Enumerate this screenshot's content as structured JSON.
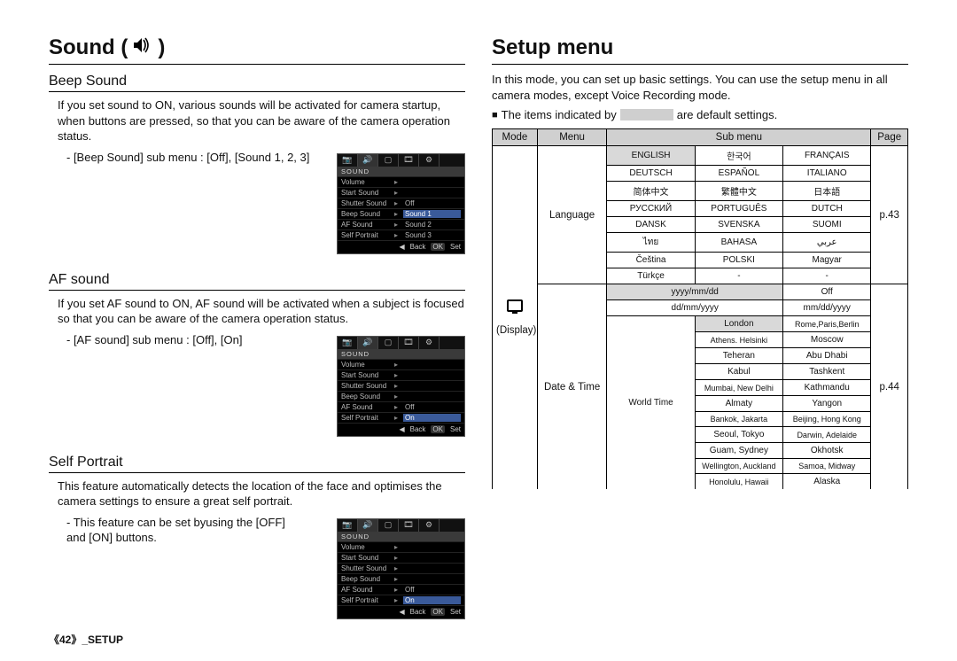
{
  "footer": "《42》_SETUP",
  "left": {
    "title_prefix": "Sound (",
    "title_suffix": ")",
    "sections": {
      "beep": {
        "heading": "Beep Sound",
        "body": "If you set sound to ON, various sounds will be activated for camera startup, when buttons are pressed, so that you can be aware of the camera operation status.",
        "submenu": "- [Beep Sound] sub menu : [Off], [Sound 1, 2, 3]",
        "lcd": {
          "group": "SOUND",
          "rows": [
            {
              "k": "Volume",
              "v": "",
              "sel": false
            },
            {
              "k": "Start Sound",
              "v": "",
              "sel": false
            },
            {
              "k": "Shutter Sound",
              "v": "Off",
              "sel": false
            },
            {
              "k": "Beep Sound",
              "v": "Sound 1",
              "sel": true
            },
            {
              "k": "AF Sound",
              "v": "Sound 2",
              "sel": false
            },
            {
              "k": "Self Portrait",
              "v": "Sound 3",
              "sel": false
            }
          ]
        }
      },
      "af": {
        "heading": "AF sound",
        "body": "If you set AF sound to ON, AF sound will be activated when a subject is focused so that you can be aware of the camera operation status.",
        "submenu": "- [AF sound] sub menu : [Off], [On]",
        "lcd": {
          "group": "SOUND",
          "rows": [
            {
              "k": "Volume",
              "v": "",
              "sel": false
            },
            {
              "k": "Start Sound",
              "v": "",
              "sel": false
            },
            {
              "k": "Shutter Sound",
              "v": "",
              "sel": false
            },
            {
              "k": "Beep Sound",
              "v": "",
              "sel": false
            },
            {
              "k": "AF Sound",
              "v": "Off",
              "sel": false
            },
            {
              "k": "Self Portrait",
              "v": "On",
              "sel": true
            }
          ]
        }
      },
      "self": {
        "heading": "Self Portrait",
        "body": "This feature automatically detects the location of the face and optimises the camera settings to ensure a great self portrait.",
        "submenu": "- This feature can be set byusing the [OFF] and [ON] buttons.",
        "lcd": {
          "group": "SOUND",
          "rows": [
            {
              "k": "Volume",
              "v": "",
              "sel": false
            },
            {
              "k": "Start Sound",
              "v": "",
              "sel": false
            },
            {
              "k": "Shutter Sound",
              "v": "",
              "sel": false
            },
            {
              "k": "Beep Sound",
              "v": "",
              "sel": false
            },
            {
              "k": "AF Sound",
              "v": "Off",
              "sel": false
            },
            {
              "k": "Self Portrait",
              "v": "On",
              "sel": true
            }
          ]
        }
      },
      "lcd_footer": {
        "back": "Back",
        "ok": "OK",
        "set": "Set"
      }
    }
  },
  "right": {
    "title": "Setup menu",
    "intro": "In this mode, you can set up basic settings. You can use the setup menu in all camera modes, except Voice Recording mode.",
    "note_prefix": "The items indicated by",
    "note_suffix": "are default settings.",
    "table": {
      "headers": {
        "mode": "Mode",
        "menu": "Menu",
        "submenu": "Sub menu",
        "page": "Page"
      },
      "mode_label": "(Display)",
      "language": {
        "label": "Language",
        "page": "p.43",
        "rows": [
          [
            "ENGLISH",
            "한국어",
            "FRANÇAIS"
          ],
          [
            "DEUTSCH",
            "ESPAÑOL",
            "ITALIANO"
          ],
          [
            "简体中文",
            "繁體中文",
            "日本語"
          ],
          [
            "РУССКИЙ",
            "PORTUGUÊS",
            "DUTCH"
          ],
          [
            "DANSK",
            "SVENSKA",
            "SUOMI"
          ],
          [
            "ไทย",
            "BAHASA",
            "عربي"
          ],
          [
            "Čeština",
            "POLSKI",
            "Magyar"
          ],
          [
            "Türkçe",
            "-",
            "-"
          ]
        ]
      },
      "datetime": {
        "label": "Date & Time",
        "page": "p.44",
        "format_rows": [
          {
            "a": "yyyy/mm/dd",
            "b": "Off",
            "default": "a"
          },
          {
            "a": "dd/mm/yyyy",
            "b": "mm/dd/yyyy",
            "default": null
          }
        ],
        "worldtime_label": "World Time",
        "cities": [
          [
            "London",
            "Rome,Paris,Berlin"
          ],
          [
            "Athens. Helsinki",
            "Moscow"
          ],
          [
            "Teheran",
            "Abu Dhabi"
          ],
          [
            "Kabul",
            "Tashkent"
          ],
          [
            "Mumbai, New Delhi",
            "Kathmandu"
          ],
          [
            "Almaty",
            "Yangon"
          ],
          [
            "Bankok, Jakarta",
            "Beijing, Hong Kong"
          ],
          [
            "Seoul, Tokyo",
            "Darwin, Adelaide"
          ],
          [
            "Guam, Sydney",
            "Okhotsk"
          ],
          [
            "Wellington, Auckland",
            "Samoa, Midway"
          ],
          [
            "Honolulu, Hawaii",
            "Alaska"
          ]
        ]
      }
    }
  }
}
